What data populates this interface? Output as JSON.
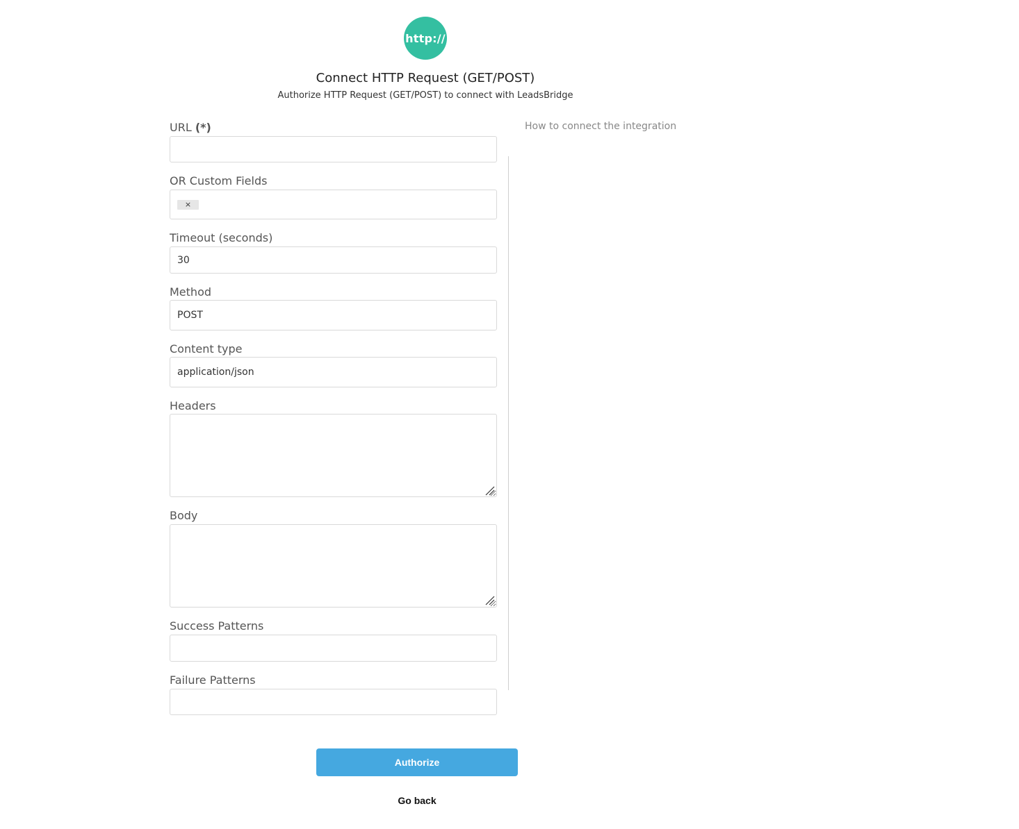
{
  "header": {
    "logo_text": "http://",
    "title": "Connect HTTP Request (GET/POST)",
    "subtitle": "Authorize HTTP Request (GET/POST) to connect with LeadsBridge"
  },
  "help": {
    "link_text": "How to connect the integration"
  },
  "form": {
    "url": {
      "label": "URL",
      "required_marker": "(*)",
      "value": ""
    },
    "custom_fields": {
      "label": "OR Custom Fields",
      "tag_remove": "×"
    },
    "timeout": {
      "label": "Timeout (seconds)",
      "value": "30"
    },
    "method": {
      "label": "Method",
      "value": "POST"
    },
    "content_type": {
      "label": "Content type",
      "value": "application/json"
    },
    "headers": {
      "label": "Headers",
      "value": ""
    },
    "body": {
      "label": "Body",
      "value": ""
    },
    "success_patterns": {
      "label": "Success Patterns",
      "value": ""
    },
    "failure_patterns": {
      "label": "Failure Patterns",
      "value": ""
    }
  },
  "actions": {
    "authorize_label": "Authorize",
    "go_back_label": "Go back"
  },
  "colors": {
    "logo_bg": "#34bfa1",
    "primary_button": "#45a8e0"
  }
}
